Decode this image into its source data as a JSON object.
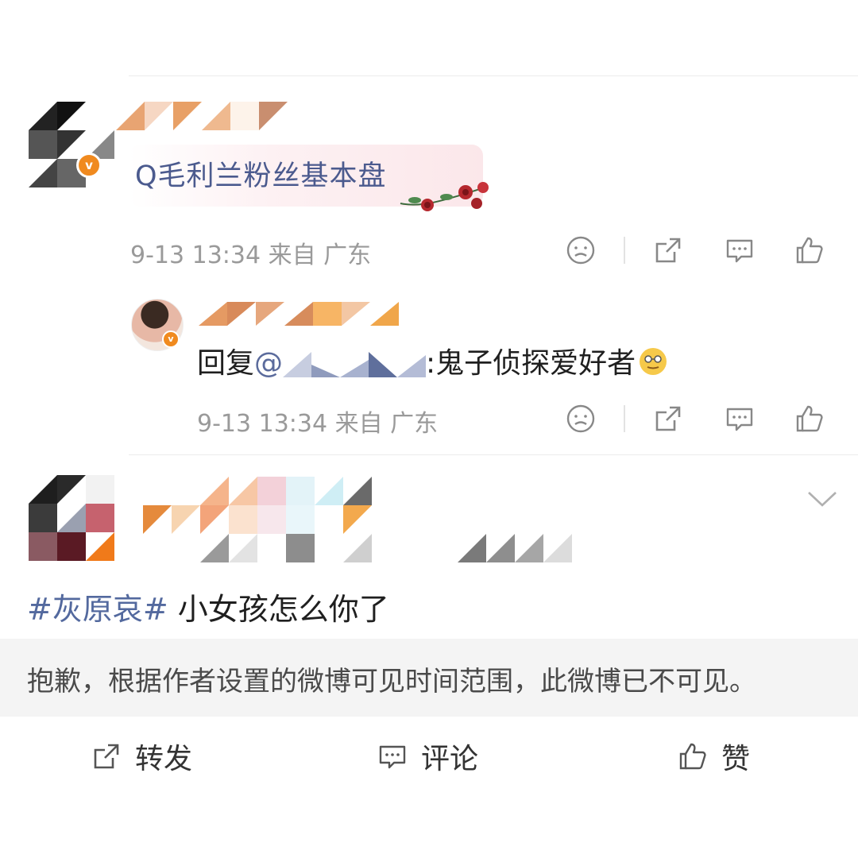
{
  "top_comment": {
    "tag": "Q毛利兰粉丝基本盘",
    "time": "9-13 13:34 来自 广东"
  },
  "reply": {
    "prefix": "回复",
    "at": "@",
    "text": ":鬼子侦探爱好者",
    "time": "9-13 13:34 来自 广东"
  },
  "post": {
    "hashtag": "#灰原哀#",
    "text": " 小女孩怎么你了",
    "notice": "抱歉，根据作者设置的微博可见时间范围，此微博已不可见。"
  },
  "actions": {
    "repost": "转发",
    "comment": "评论",
    "like": "赞"
  },
  "icons": {
    "dislike": "frown-face-icon",
    "share": "share-icon",
    "comment": "comment-bubble-icon",
    "like": "thumbs-up-icon",
    "emoji": "nerd-emoji-icon",
    "expand": "chevron-down-icon"
  },
  "colors": {
    "link": "#53699e",
    "verified": "#f08a1f",
    "muted": "#9a9a9a"
  }
}
